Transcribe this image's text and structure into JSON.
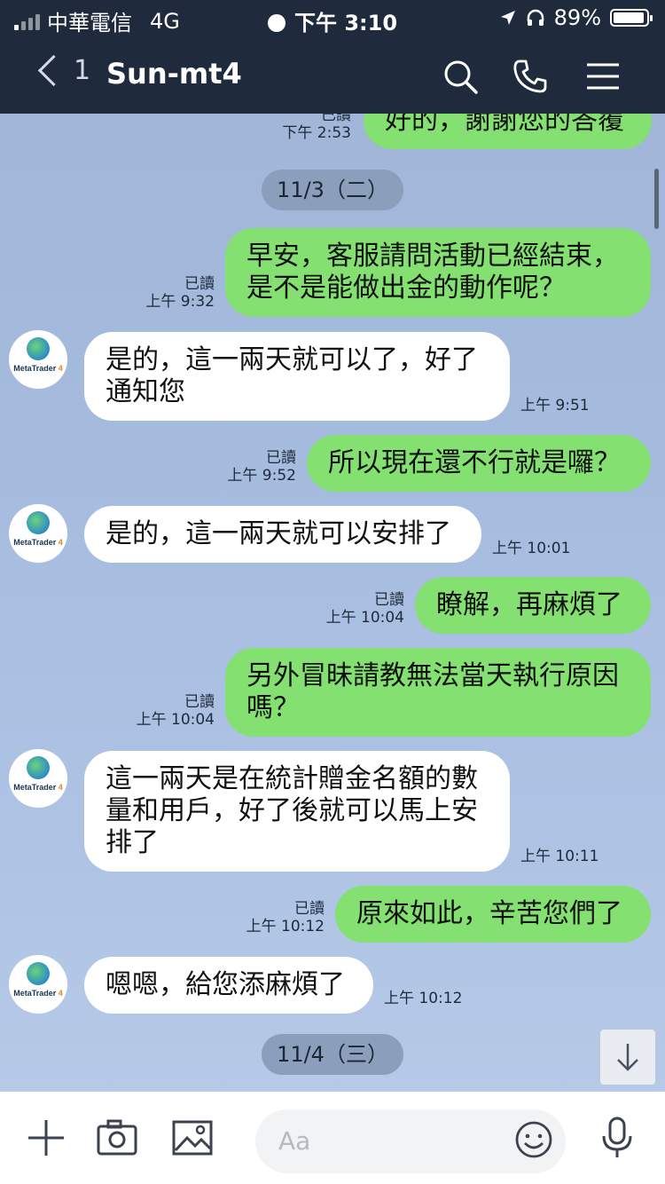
{
  "status_bar": {
    "carrier": "中華電信",
    "network": "4G",
    "time": "下午 3:10",
    "battery": "89%"
  },
  "header": {
    "back_count": "1",
    "title": "Sun-mt4"
  },
  "messages": [
    {
      "sender": "me",
      "text": "好的，謝謝您的答覆",
      "read": "已讀",
      "time": "下午 2:53"
    },
    {
      "type": "date",
      "text": "11/3（二）"
    },
    {
      "sender": "me",
      "text": "早安，客服請問活動已經結束，\n是不是能做出金的動作呢？",
      "read": "已讀",
      "time": "上午 9:32"
    },
    {
      "sender": "them",
      "text": "是的，這一兩天就可以了，好了\n通知您",
      "time": "上午 9:51"
    },
    {
      "sender": "me",
      "text": "所以現在還不行就是囉？",
      "read": "已讀",
      "time": "上午 9:52"
    },
    {
      "sender": "them",
      "text": "是的，這一兩天就可以安排了",
      "time": "上午 10:01"
    },
    {
      "sender": "me",
      "text": "瞭解，再麻煩了",
      "read": "已讀",
      "time": "上午 10:04"
    },
    {
      "sender": "me",
      "text": "另外冒昧請教無法當天執行原因\n嗎？",
      "read": "已讀",
      "time": "上午 10:04"
    },
    {
      "sender": "them",
      "text": "這一兩天是在統計贈金名額的數\n量和用戶，好了後就可以馬上安\n排了",
      "time": "上午 10:11"
    },
    {
      "sender": "me",
      "text": "原來如此，辛苦您們了",
      "read": "已讀",
      "time": "上午 10:12"
    },
    {
      "sender": "them",
      "text": "嗯嗯，給您添麻煩了",
      "time": "上午 10:12"
    },
    {
      "type": "date",
      "text": "11/4（三）"
    }
  ],
  "avatar_label": {
    "brand": "MetaTrader",
    "version": "4"
  },
  "input_bar": {
    "placeholder": "Aa"
  },
  "colors": {
    "header_bg": "#1f2b3d",
    "my_bubble": "#84e070",
    "their_bubble": "#ffffff",
    "chat_bg": "#a6bcdf"
  }
}
